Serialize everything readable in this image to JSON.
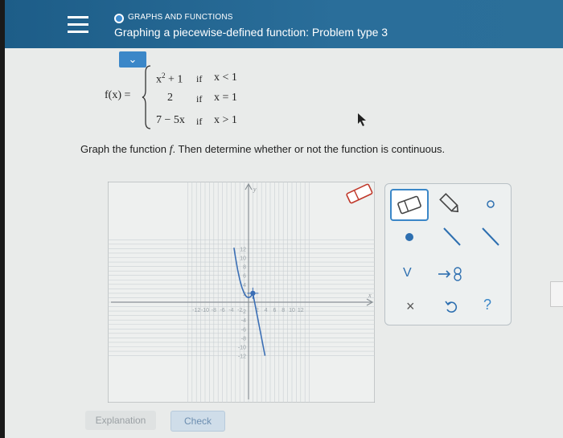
{
  "header": {
    "category": "GRAPHS AND FUNCTIONS",
    "title": "Graphing a piecewise-defined function: Problem type 3"
  },
  "function": {
    "name": "f(x) =",
    "pieces": [
      {
        "expr_base": "x",
        "expr_exp": "2",
        "expr_rest": "+ 1",
        "cond_if": "if",
        "cond": "x < 1"
      },
      {
        "expr": "2",
        "cond_if": "if",
        "cond": "x = 1"
      },
      {
        "expr": "7 − 5x",
        "cond_if": "if",
        "cond": "x > 1"
      }
    ]
  },
  "instruction": {
    "pre": "Graph the function ",
    "var": "f",
    "post": ". Then determine whether or not the function is continuous."
  },
  "chart_data": {
    "type": "line",
    "xlim": [
      -14,
      14
    ],
    "ylim": [
      -12,
      14
    ],
    "x_tick_labels": [
      "-12",
      "-10",
      "-8",
      "-6",
      "-4",
      "-2",
      "2",
      "4",
      "6",
      "8",
      "10",
      "12"
    ],
    "y_tick_labels": [
      "12",
      "10",
      "8",
      "6",
      "4",
      "2",
      "-2",
      "-4",
      "-6",
      "-8",
      "-10",
      "-12"
    ],
    "xlabel": "x",
    "ylabel": "y",
    "grid": true,
    "series": [
      {
        "x": [
          -3.35,
          -3,
          -2.5,
          -2,
          -1.5,
          -1,
          -0.5,
          0,
          0.5,
          1
        ],
        "y": [
          12.2,
          10,
          7.25,
          5,
          3.25,
          2,
          1.25,
          1,
          1.25,
          2
        ]
      },
      {
        "x": [
          1,
          3.8
        ],
        "y": [
          2,
          -12
        ]
      }
    ],
    "points": [
      {
        "x": 1,
        "y": 2
      }
    ]
  },
  "tools": {
    "labels": [
      "",
      "",
      "",
      "",
      "",
      "",
      "V",
      "",
      "×",
      "",
      "?"
    ]
  },
  "buttons": {
    "explanation": "Explanation",
    "check": "Check"
  },
  "colors": {
    "header": "#2a6e9a",
    "accent": "#3b87c8",
    "curve": "#3b6fb5"
  }
}
